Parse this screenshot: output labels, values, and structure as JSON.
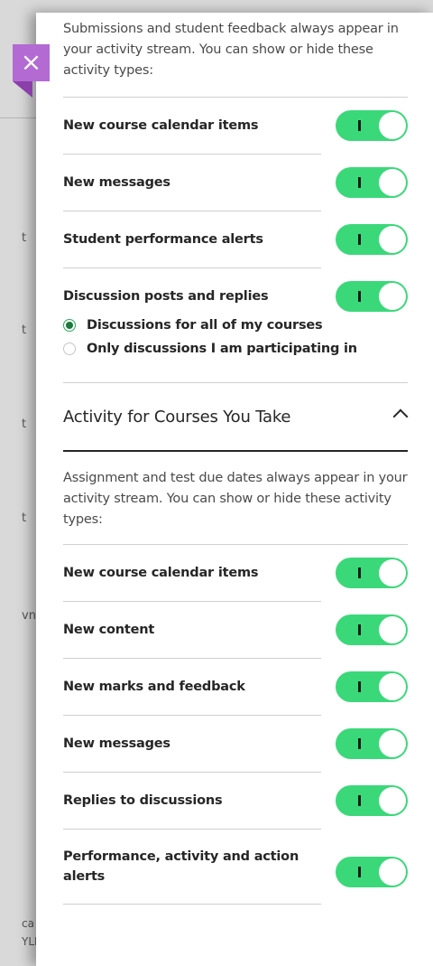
{
  "background": {
    "fragments": [
      "t",
      "t",
      "t",
      "t",
      "vni"
    ],
    "footer_lines": [
      "ca A",
      "YLLA"
    ]
  },
  "close_button": {
    "icon": "close-icon",
    "glyph": "×"
  },
  "section_teach": {
    "intro": "Submissions and student feedback always appear in your activity stream. You can show or hide these activity types:",
    "items": [
      {
        "label": "New course calendar items",
        "on": true
      },
      {
        "label": "New messages",
        "on": true
      },
      {
        "label": "Student performance alerts",
        "on": true
      },
      {
        "label": "Discussion posts and replies",
        "on": true
      }
    ],
    "radio_options": [
      {
        "label": "Discussions for all of my courses",
        "checked": true
      },
      {
        "label": "Only discussions I am participating in",
        "checked": false
      }
    ]
  },
  "section_take": {
    "title": "Activity for Courses You Take",
    "intro": "Assignment and test due dates always appear in your activity stream. You can show or hide these activity types:",
    "items": [
      {
        "label": "New course calendar items",
        "on": true
      },
      {
        "label": "New content",
        "on": true
      },
      {
        "label": "New marks and feedback",
        "on": true
      },
      {
        "label": "New messages",
        "on": true
      },
      {
        "label": "Replies to discussions",
        "on": true
      },
      {
        "label": "Performance, activity and action alerts",
        "on": true
      }
    ]
  },
  "colors": {
    "toggle_on": "#3bd87a",
    "close_tab": "#b36ad3",
    "radio_checked": "#1a7a3a"
  }
}
